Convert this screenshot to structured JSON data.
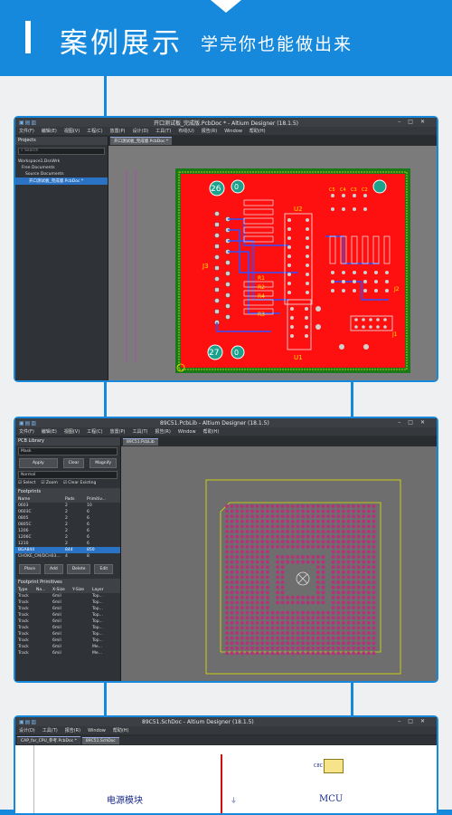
{
  "header": {
    "title": "案例展示",
    "subtitle": "学完你也能做出来"
  },
  "shot1": {
    "window_title": "开口测试板_完成版.PcbDoc * - Altium Designer (18.1.5)",
    "menu": [
      "文件(F)",
      "编辑(E)",
      "视图(V)",
      "工程(C)",
      "放置(P)",
      "设计(D)",
      "工具(T)",
      "布线(U)",
      "报告(R)",
      "Window",
      "帮助(H)"
    ],
    "panel_title": "Projects",
    "search_placeholder": "Search",
    "tree": [
      "Workspace1.DsnWrk",
      "Free Documents",
      "Source Documents",
      "开口测试板_完成版.PcbDoc *"
    ],
    "tab": "开口测试板_完成版.PcbDoc *",
    "labels": {
      "hole_a": "26",
      "hole_b": "27",
      "hole_c": "0",
      "hole_d": "0",
      "connector": "J3",
      "u2": "U2",
      "u1": "U1",
      "r1": "R1",
      "r2": "R2",
      "r4": "R4",
      "r3": "R3",
      "j1": "J1",
      "j2": "J2",
      "caps": [
        "C5",
        "C4",
        "C3",
        "C2"
      ]
    }
  },
  "shot2": {
    "window_title": "89C51.PcbLib - Altium Designer (18.1.5)",
    "menu": [
      "文件(F)",
      "编辑(E)",
      "视图(V)",
      "工程(C)",
      "放置(P)",
      "工具(T)",
      "报告(R)",
      "Window",
      "帮助(H)"
    ],
    "panel_title": "PCB Library",
    "mask_label": "Mask",
    "buttons": {
      "apply": "Apply",
      "clear": "Clear",
      "magnify": "Magnify"
    },
    "mode": "Normal",
    "checks": [
      "Select",
      "Zoom",
      "Clear Existing"
    ],
    "footprints_title": "Footprints",
    "fp_headers": [
      "Name",
      "Pads",
      "Primitiv..."
    ],
    "footprints": [
      {
        "name": "0603",
        "pads": "2",
        "prims": "10"
      },
      {
        "name": "0603C",
        "pads": "2",
        "prims": "6"
      },
      {
        "name": "0805",
        "pads": "2",
        "prims": "6"
      },
      {
        "name": "0805C",
        "pads": "2",
        "prims": "6"
      },
      {
        "name": "1206",
        "pads": "2",
        "prims": "6"
      },
      {
        "name": "1206C",
        "pads": "2",
        "prims": "6"
      },
      {
        "name": "1210",
        "pads": "2",
        "prims": "6"
      },
      {
        "name": "BGA844",
        "pads": "844",
        "prims": "850"
      },
      {
        "name": "CHOKE_CM/DCH03...",
        "pads": "4",
        "prims": "8"
      }
    ],
    "fp_buttons": {
      "place": "Place",
      "add": "Add",
      "delete": "Delete",
      "edit": "Edit"
    },
    "prims_title": "Footprint Primitives",
    "prim_headers": [
      "Type",
      "Na...",
      "X-Size",
      "Y-Size",
      "Layer"
    ],
    "primitives": [
      {
        "type": "Track",
        "size": "6mil",
        "layer": "Top..."
      },
      {
        "type": "Track",
        "size": "6mil",
        "layer": "Top..."
      },
      {
        "type": "Track",
        "size": "6mil",
        "layer": "Top..."
      },
      {
        "type": "Track",
        "size": "6mil",
        "layer": "Top..."
      },
      {
        "type": "Track",
        "size": "6mil",
        "layer": "Top..."
      },
      {
        "type": "Track",
        "size": "6mil",
        "layer": "Top..."
      },
      {
        "type": "Track",
        "size": "6mil",
        "layer": "Top..."
      },
      {
        "type": "Track",
        "size": "6mil",
        "layer": "Top..."
      },
      {
        "type": "Track",
        "size": "6mil",
        "layer": "Me..."
      },
      {
        "type": "Track",
        "size": "6mil",
        "layer": "Me..."
      }
    ],
    "tab": "89C51.PcbLib"
  },
  "shot3": {
    "window_title": "89C51.SchDoc - Altium Designer (18.1.5)",
    "menu": [
      "设计(D)",
      "工具(T)",
      "报告(R)",
      "Window",
      "帮助(H)"
    ],
    "tabs": [
      "CAP_for_CPU_参考.PcbDoc *",
      "89C51.SchDoc"
    ],
    "block_power": "电源模块",
    "block_mcu": "MCU",
    "part_ref": "C8C"
  },
  "colors": {
    "brand_blue": "#1789dc",
    "board_red": "#ff1010",
    "pad_magenta": "#b8307a"
  }
}
